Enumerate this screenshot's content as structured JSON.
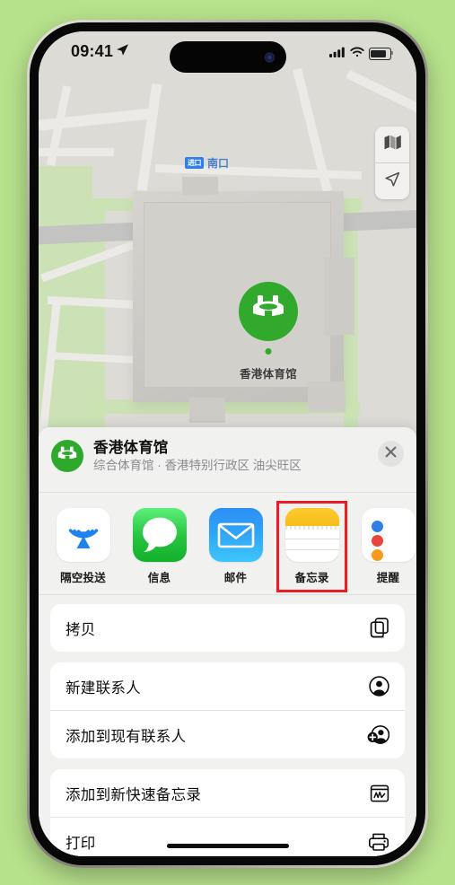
{
  "status_bar": {
    "time": "09:41",
    "location_arrow": "location-arrow-icon",
    "cellular": "cellular-bars-icon",
    "wifi": "wifi-icon",
    "battery": "battery-icon"
  },
  "map": {
    "entry_badge": "进口",
    "entry_label": "南口",
    "pin_label": "香港体育馆",
    "controls": [
      {
        "name": "map-type-button",
        "icon": "map-icon"
      },
      {
        "name": "locate-me-button",
        "icon": "navigation-arrow-icon"
      }
    ]
  },
  "share_sheet": {
    "title": "香港体育馆",
    "subtitle": "综合体育馆 · 香港特别行政区 油尖旺区",
    "close_icon": "close-icon",
    "apps": [
      {
        "label": "隔空投送",
        "icon": "airdrop-icon",
        "highlighted": false
      },
      {
        "label": "信息",
        "icon": "messages-icon",
        "highlighted": false
      },
      {
        "label": "邮件",
        "icon": "mail-icon",
        "highlighted": false
      },
      {
        "label": "备忘录",
        "icon": "notes-icon",
        "highlighted": true
      },
      {
        "label": "提醒",
        "icon": "reminders-icon",
        "highlighted": false
      }
    ],
    "action_groups": [
      {
        "rows": [
          {
            "label": "拷贝",
            "icon": "copy-icon"
          }
        ]
      },
      {
        "rows": [
          {
            "label": "新建联系人",
            "icon": "person-circle-icon"
          },
          {
            "label": "添加到现有联系人",
            "icon": "person-badge-plus-icon"
          }
        ]
      },
      {
        "rows": [
          {
            "label": "添加到新快速备忘录",
            "icon": "quick-note-icon"
          },
          {
            "label": "打印",
            "icon": "printer-icon"
          }
        ]
      }
    ]
  },
  "colors": {
    "background": "#b7e28c",
    "accent_green": "#30a92c",
    "highlight_red": "#ec1c24",
    "sheet_bg": "#f1f1f0"
  }
}
